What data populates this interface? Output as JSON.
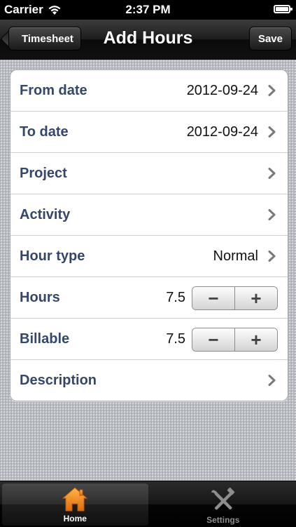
{
  "status_bar": {
    "carrier": "Carrier",
    "time": "2:37 PM"
  },
  "nav_bar": {
    "back_label": "Timesheet",
    "title": "Add Hours",
    "save_label": "Save"
  },
  "form": {
    "from_date": {
      "label": "From date",
      "value": "2012-09-24"
    },
    "to_date": {
      "label": "To date",
      "value": "2012-09-24"
    },
    "project": {
      "label": "Project",
      "value": ""
    },
    "activity": {
      "label": "Activity",
      "value": ""
    },
    "hour_type": {
      "label": "Hour type",
      "value": "Normal"
    },
    "hours": {
      "label": "Hours",
      "value": "7.5",
      "minus": "−",
      "plus": "+"
    },
    "billable": {
      "label": "Billable",
      "value": "7.5",
      "minus": "−",
      "plus": "+"
    },
    "description": {
      "label": "Description",
      "value": ""
    }
  },
  "tab_bar": {
    "tabs": [
      {
        "label": "Home",
        "icon": "house-icon",
        "selected": true
      },
      {
        "label": "Settings",
        "icon": "tools-icon",
        "selected": false
      }
    ]
  },
  "colors": {
    "label_blue": "#34476b",
    "home_icon_orange": "#f08a1c"
  }
}
